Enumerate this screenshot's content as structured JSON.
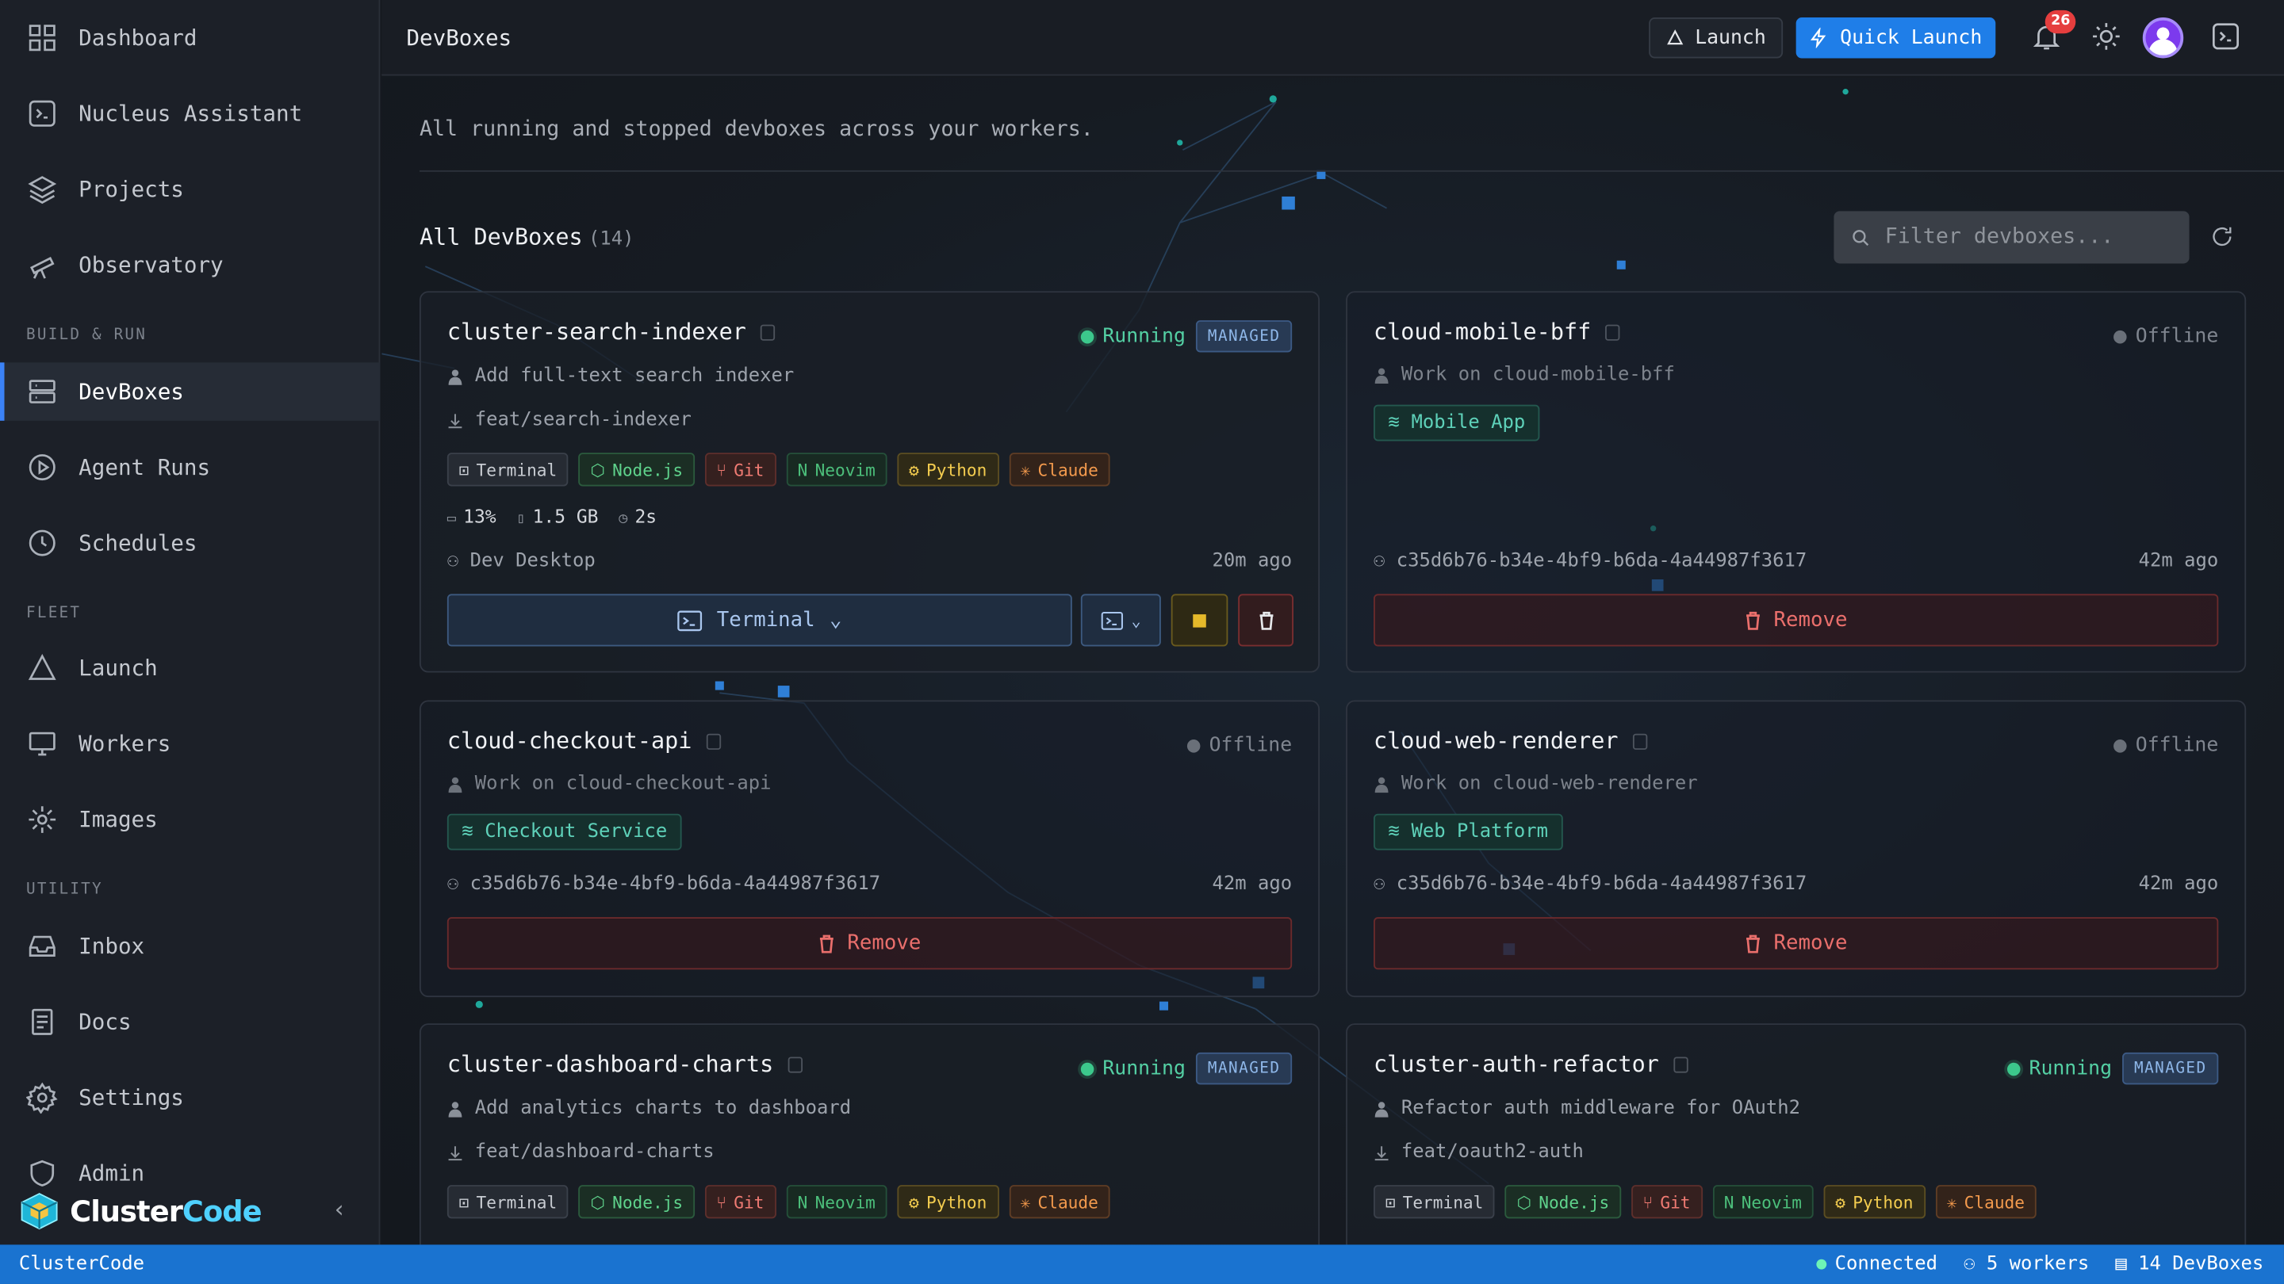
{
  "sidebar": {
    "items_top": [
      {
        "label": "Dashboard",
        "icon": "dashboard-icon"
      },
      {
        "label": "Nucleus Assistant",
        "icon": "assistant-icon"
      },
      {
        "label": "Projects",
        "icon": "layers-icon"
      },
      {
        "label": "Observatory",
        "icon": "telescope-icon"
      }
    ],
    "section_build": "BUILD & RUN",
    "items_build": [
      {
        "label": "DevBoxes",
        "icon": "server-icon",
        "active": true
      },
      {
        "label": "Agent Runs",
        "icon": "play-circle-icon"
      },
      {
        "label": "Schedules",
        "icon": "clock-icon"
      }
    ],
    "section_fleet": "FLEET",
    "items_fleet": [
      {
        "label": "Launch",
        "icon": "triangle-icon"
      },
      {
        "label": "Workers",
        "icon": "monitor-icon"
      },
      {
        "label": "Images",
        "icon": "gear-icon"
      }
    ],
    "section_utility": "UTILITY",
    "items_utility": [
      {
        "label": "Inbox",
        "icon": "inbox-icon"
      },
      {
        "label": "Docs",
        "icon": "document-icon"
      },
      {
        "label": "Settings",
        "icon": "settings-icon"
      },
      {
        "label": "Admin",
        "icon": "shield-icon"
      }
    ],
    "brand_prefix": "Cluster",
    "brand_suffix": "Code"
  },
  "topbar": {
    "title": "DevBoxes",
    "launch_label": "Launch",
    "quick_launch_label": "Quick Launch",
    "notification_count": "26"
  },
  "main": {
    "subtitle": "All running and stopped devboxes across your workers.",
    "section_title": "All DevBoxes",
    "section_count": "(14)",
    "filter_placeholder": "Filter devboxes..."
  },
  "cards": [
    {
      "name": "cluster-search-indexer",
      "status": "Running",
      "managed": "MANAGED",
      "description": "Add full-text search indexer",
      "branch": "feat/search-indexer",
      "tags": [
        "Terminal",
        "Node.js",
        "Git",
        "Neovim",
        "Python",
        "Claude"
      ],
      "cpu": "13%",
      "mem": "1.5 GB",
      "uptime": "2s",
      "owner": "Dev Desktop",
      "ago": "20m ago",
      "terminal_label": "Terminal"
    },
    {
      "name": "cloud-mobile-bff",
      "status": "Offline",
      "description": "Work on cloud-mobile-bff",
      "project": "Mobile App",
      "owner": "c35d6b76-b34e-4bf9-b6da-4a44987f3617",
      "ago": "42m ago",
      "remove_label": "Remove"
    },
    {
      "name": "cloud-checkout-api",
      "status": "Offline",
      "description": "Work on cloud-checkout-api",
      "project": "Checkout Service",
      "owner": "c35d6b76-b34e-4bf9-b6da-4a44987f3617",
      "ago": "42m ago",
      "remove_label": "Remove"
    },
    {
      "name": "cloud-web-renderer",
      "status": "Offline",
      "description": "Work on cloud-web-renderer",
      "project": "Web Platform",
      "owner": "c35d6b76-b34e-4bf9-b6da-4a44987f3617",
      "ago": "42m ago",
      "remove_label": "Remove"
    },
    {
      "name": "cluster-dashboard-charts",
      "status": "Running",
      "managed": "MANAGED",
      "description": "Add analytics charts to dashboard",
      "branch": "feat/dashboard-charts",
      "tags": [
        "Terminal",
        "Node.js",
        "Git",
        "Neovim",
        "Python",
        "Claude"
      ]
    },
    {
      "name": "cluster-auth-refactor",
      "status": "Running",
      "managed": "MANAGED",
      "description": "Refactor auth middleware for OAuth2",
      "branch": "feat/oauth2-auth",
      "tags": [
        "Terminal",
        "Node.js",
        "Git",
        "Neovim",
        "Python",
        "Claude"
      ]
    }
  ],
  "statusbar": {
    "app": "ClusterCode",
    "connection": "Connected",
    "workers": "5 workers",
    "devboxes": "14 DevBoxes"
  },
  "colors": {
    "accent": "#1f7ee8",
    "statusbar": "#1a73d0",
    "running": "#3cc88c",
    "danger": "#ea6f6c"
  }
}
